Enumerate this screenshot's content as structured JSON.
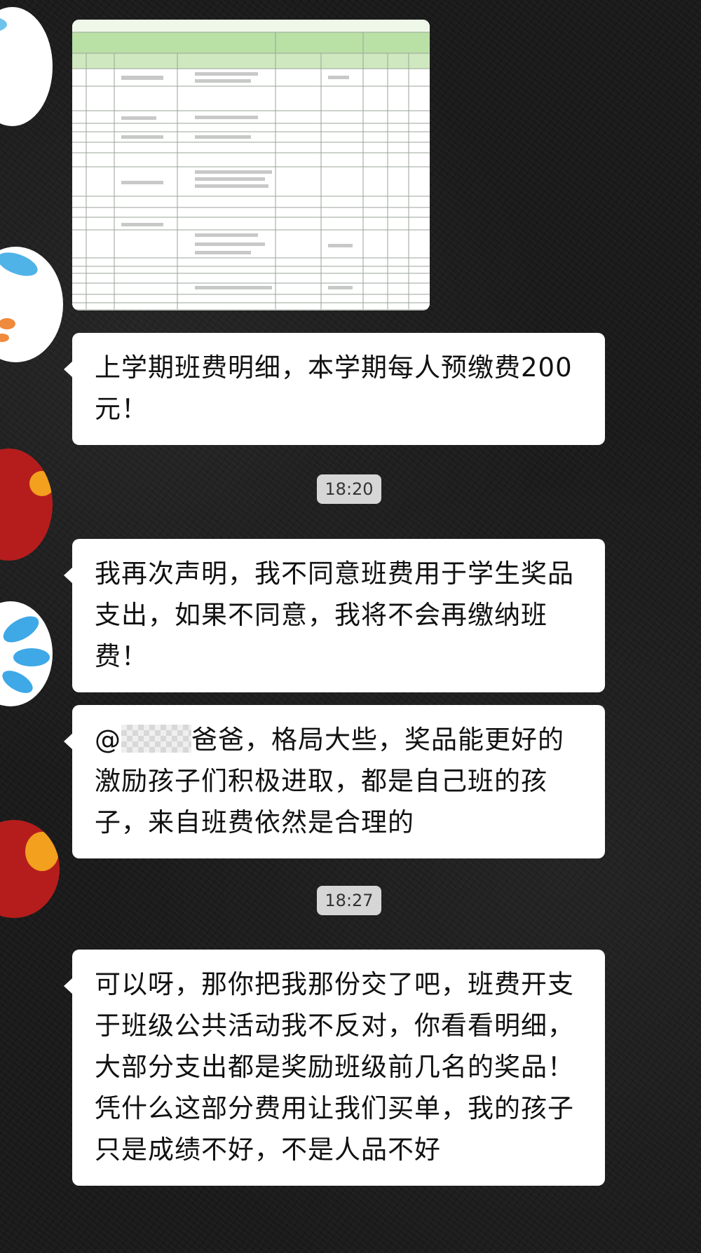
{
  "messages": [
    {
      "type": "image",
      "description_icon": "spreadsheet-image"
    },
    {
      "type": "text",
      "text": "上学期班费明细，本学期每人预缴费200元！"
    },
    {
      "type": "time",
      "text": "18:20"
    },
    {
      "type": "text",
      "text": "我再次声明，我不同意班费用于学生奖品支出，如果不同意，我将不会再缴纳班费！"
    },
    {
      "type": "text",
      "mention_prefix": "@",
      "text": "爸爸，格局大些，奖品能更好的激励孩子们积极进取，都是自己班的孩子，来自班费依然是合理的"
    },
    {
      "type": "time",
      "text": "18:27"
    },
    {
      "type": "text",
      "text": "可以呀，那你把我那份交了吧，班费开支于班级公共活动我不反对，你看看明细，大部分支出都是奖励班级前几名的奖品！凭什么这部分费用让我们买单，我的孩子只是成绩不好，不是人品不好"
    }
  ],
  "colors": {
    "bubble": "#ffffff",
    "timestamp_bg": "#d6d6d6",
    "sheet_header_green": "#b9e0a5"
  }
}
